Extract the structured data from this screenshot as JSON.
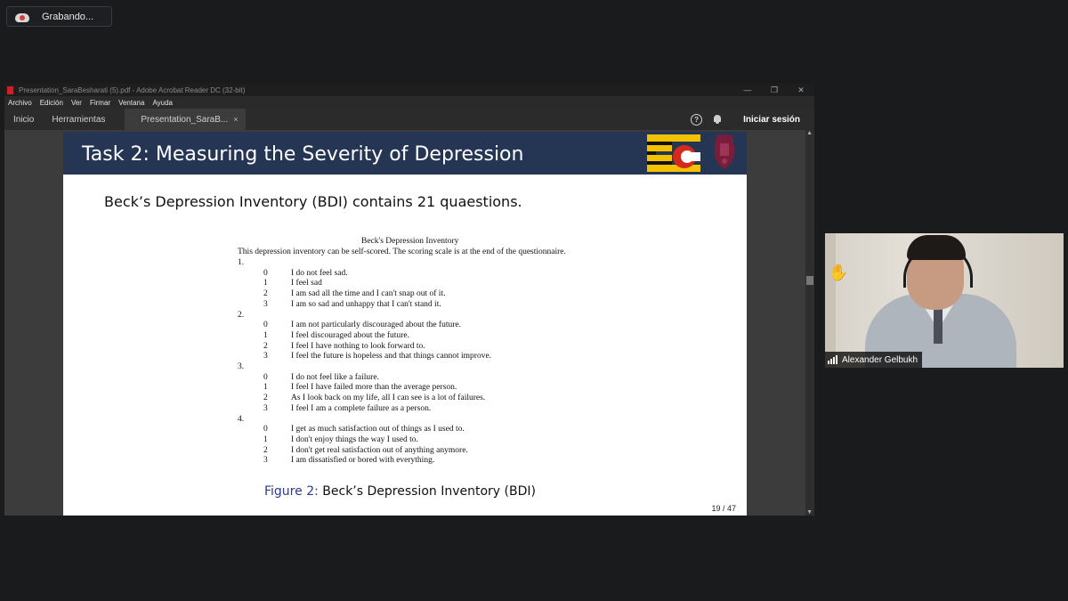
{
  "recording": {
    "label": "Grabando..."
  },
  "window": {
    "title": "Presentation_SaraBesharati (5).pdf - Adobe Acrobat Reader DC (32-bit)",
    "pdf_icon": "pdf-file-icon",
    "controls": [
      "—",
      "❐",
      "✕"
    ]
  },
  "menu": [
    "Archivo",
    "Edición",
    "Ver",
    "Firmar",
    "Ventana",
    "Ayuda"
  ],
  "tabs": {
    "home": "Inicio",
    "tools": "Herramientas",
    "document": "Presentation_SaraB...",
    "close": "×",
    "help": "?",
    "signin": "Iniciar sesión"
  },
  "slide": {
    "title": "Task 2: Measuring the Severity of Depression",
    "subtitle": "Beck’s Depression Inventory (BDI) contains 21 quaestions.",
    "bdi_title": "Beck's Depression Inventory",
    "bdi_intro": "This depression inventory can be self-scored. The scoring scale is at the end of the questionnaire.",
    "questions": [
      {
        "num": "1.",
        "options": [
          {
            "score": "0",
            "text": "I do not feel sad."
          },
          {
            "score": "1",
            "text": "I feel sad"
          },
          {
            "score": "2",
            "text": "I am sad all the time and I can't snap out of it."
          },
          {
            "score": "3",
            "text": "I am so sad and unhappy that I can't stand it."
          }
        ]
      },
      {
        "num": "2.",
        "options": [
          {
            "score": "0",
            "text": "I am not particularly discouraged about the future."
          },
          {
            "score": "1",
            "text": "I feel discouraged about the future."
          },
          {
            "score": "2",
            "text": "I feel I have nothing to look forward to."
          },
          {
            "score": "3",
            "text": "I feel the future is hopeless and that things cannot improve."
          }
        ]
      },
      {
        "num": "3.",
        "options": [
          {
            "score": "0",
            "text": "I do not feel like a failure."
          },
          {
            "score": "1",
            "text": "I feel I have failed more than the average person."
          },
          {
            "score": "2",
            "text": "As I look back on my life, all I can see is a lot of failures."
          },
          {
            "score": "3",
            "text": "I feel I am a complete failure as a person."
          }
        ]
      },
      {
        "num": "4.",
        "options": [
          {
            "score": "0",
            "text": "I get as much satisfaction out of things as I used to."
          },
          {
            "score": "1",
            "text": "I don't enjoy things the way I used to."
          },
          {
            "score": "2",
            "text": "I don't get real satisfaction out of anything anymore."
          },
          {
            "score": "3",
            "text": "I am dissatisfied or bored with everything."
          }
        ]
      }
    ],
    "caption_fig": "Figure 2:",
    "caption_text": " Beck’s Depression Inventory (BDI)",
    "page": "19 / 47"
  },
  "participant": {
    "name": "Alexander Gelbukh",
    "reaction": "✋"
  }
}
